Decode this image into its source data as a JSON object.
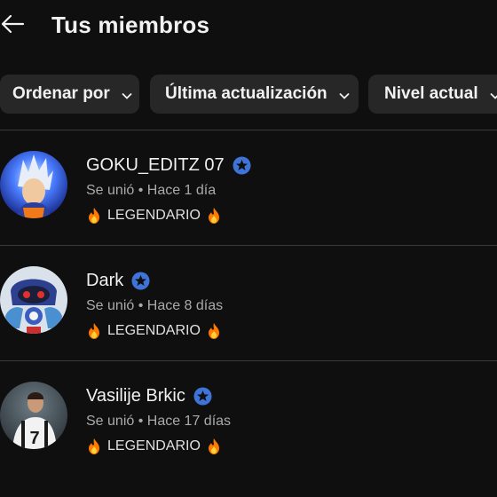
{
  "header": {
    "title": "Tus miembros"
  },
  "filters": [
    {
      "label": "Ordenar por"
    },
    {
      "label": "Última actualización"
    },
    {
      "label": "Nivel actual"
    }
  ],
  "members": [
    {
      "name": "GOKU_EDITZ 07",
      "joined": "Se unió • Hace 1 día",
      "level": "LEGENDARIO",
      "avatar_icon": "goku-avatar"
    },
    {
      "name": "Dark",
      "joined": "Se unió • Hace 8 días",
      "level": "LEGENDARIO",
      "avatar_icon": "robot-avatar"
    },
    {
      "name": "Vasilije Brkic",
      "joined": "Se unió • Hace 17 días",
      "level": "LEGENDARIO",
      "avatar_icon": "footballer-avatar"
    }
  ],
  "colors": {
    "background": "#0f0f0f",
    "chip": "#272727",
    "verified": "#3ea6ff",
    "secondary_text": "#aaaaaa",
    "fire": "#ff7a00"
  }
}
